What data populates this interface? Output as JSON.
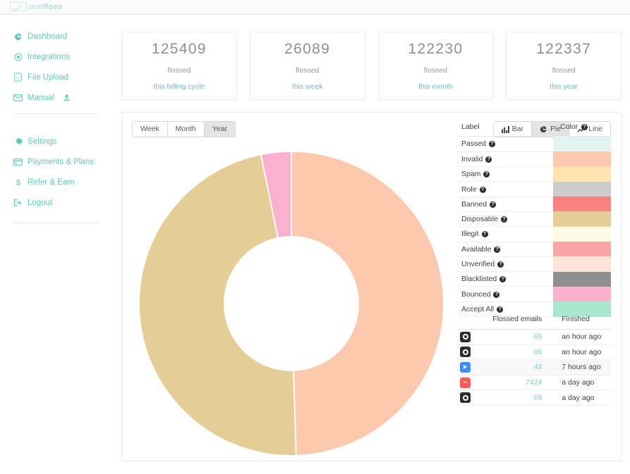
{
  "brand": {
    "logo_text_light": "mail",
    "logo_text_bold": "floss",
    "accent": "#5ec9bb",
    "period_color": "#75b7c7"
  },
  "sidebar": {
    "items": [
      {
        "label": "Dashboard",
        "icon": "pie-chart-icon"
      },
      {
        "label": "Integrations",
        "icon": "target-icon"
      },
      {
        "label": "File Upload",
        "icon": "file-spreadsheet-icon"
      },
      {
        "label": "Manual",
        "icon": "envelope-icon",
        "trailing_icon": "upload-icon"
      }
    ],
    "items_secondary": [
      {
        "label": "Settings",
        "icon": "gear-icon"
      },
      {
        "label": "Payments & Plans",
        "icon": "credit-card-icon"
      },
      {
        "label": "Refer & Earn",
        "icon": "dollar-icon"
      },
      {
        "label": "Logout",
        "icon": "logout-icon"
      }
    ]
  },
  "cards": [
    {
      "number": "125409",
      "sub": "flossed",
      "period": "this billing cycle"
    },
    {
      "number": "26089",
      "sub": "flossed",
      "period": "this week"
    },
    {
      "number": "122230",
      "sub": "flossed",
      "period": "this month"
    },
    {
      "number": "122337",
      "sub": "flossed",
      "period": "this year"
    }
  ],
  "toolbar": {
    "range_buttons": [
      {
        "label": "Week",
        "active": false
      },
      {
        "label": "Month",
        "active": false
      },
      {
        "label": "Year",
        "active": true
      }
    ],
    "chart_buttons": [
      {
        "label": "Bar",
        "icon": "bar-chart-icon",
        "active": false
      },
      {
        "label": "Pie",
        "icon": "pie-chart-icon",
        "active": true
      },
      {
        "label": "Line",
        "icon": "line-chart-icon",
        "active": false
      }
    ]
  },
  "legend": {
    "header": {
      "label": "Label",
      "color": "Color"
    },
    "rows": [
      {
        "label": "Passed",
        "color": "#e2f3f1"
      },
      {
        "label": "Invalid",
        "color": "#fcc9ae"
      },
      {
        "label": "Spam",
        "color": "#fde4ae"
      },
      {
        "label": "Role",
        "color": "#cccdcf"
      },
      {
        "label": "Banned",
        "color": "#fb8080"
      },
      {
        "label": "Disposable",
        "color": "#e5ce96"
      },
      {
        "label": "Illegit",
        "color": "#fffae8"
      },
      {
        "label": "Available",
        "color": "#fba5a8"
      },
      {
        "label": "Unverified",
        "color": "#fde4d6"
      },
      {
        "label": "Blacklisted",
        "color": "#8f8f8f"
      },
      {
        "label": "Bounced",
        "color": "#fbb0ce"
      },
      {
        "label": "Accept All",
        "color": "#a9e6cd"
      }
    ]
  },
  "jobs": {
    "headers": {
      "icon": "",
      "count": "Flossed emails",
      "finished": "Finished"
    },
    "rows": [
      {
        "icon": "hubspot-icon",
        "icon_bg": "#2b2d30",
        "glyph": "ring",
        "count": "69",
        "finished": "an hour ago"
      },
      {
        "icon": "hubspot-icon",
        "icon_bg": "#2b2d30",
        "glyph": "ring",
        "count": "69",
        "finished": "an hour ago"
      },
      {
        "icon": "sendinblue-icon",
        "icon_bg": "#3f8cf5",
        "glyph": "tri",
        "count": "43",
        "finished": "7 hours ago"
      },
      {
        "icon": "mailchimp-icon",
        "icon_bg": "#fb5b5b",
        "glyph": "wave",
        "count": "7424",
        "finished": "a day ago"
      },
      {
        "icon": "hubspot-icon",
        "icon_bg": "#2b2d30",
        "glyph": "ring",
        "count": "69",
        "finished": "a day ago"
      }
    ]
  },
  "chart_data": {
    "type": "pie",
    "variant": "donut",
    "title": "",
    "legend_position": "right",
    "categories": [
      "Invalid",
      "Disposable",
      "Bounced"
    ],
    "values": [
      49.5,
      47.3,
      3.2
    ],
    "unit": "percent",
    "colors": [
      "#fcc9ae",
      "#e5ce96",
      "#fbb0ce"
    ],
    "inner_radius_ratio": 0.44,
    "start_angle_deg": 0,
    "all_series_labels": [
      "Passed",
      "Invalid",
      "Spam",
      "Role",
      "Banned",
      "Disposable",
      "Illegit",
      "Available",
      "Unverified",
      "Blacklisted",
      "Bounced",
      "Accept All"
    ],
    "all_series_values": [
      0,
      49.5,
      0,
      0,
      0,
      47.3,
      0,
      0,
      0,
      0,
      3.2,
      0
    ]
  }
}
